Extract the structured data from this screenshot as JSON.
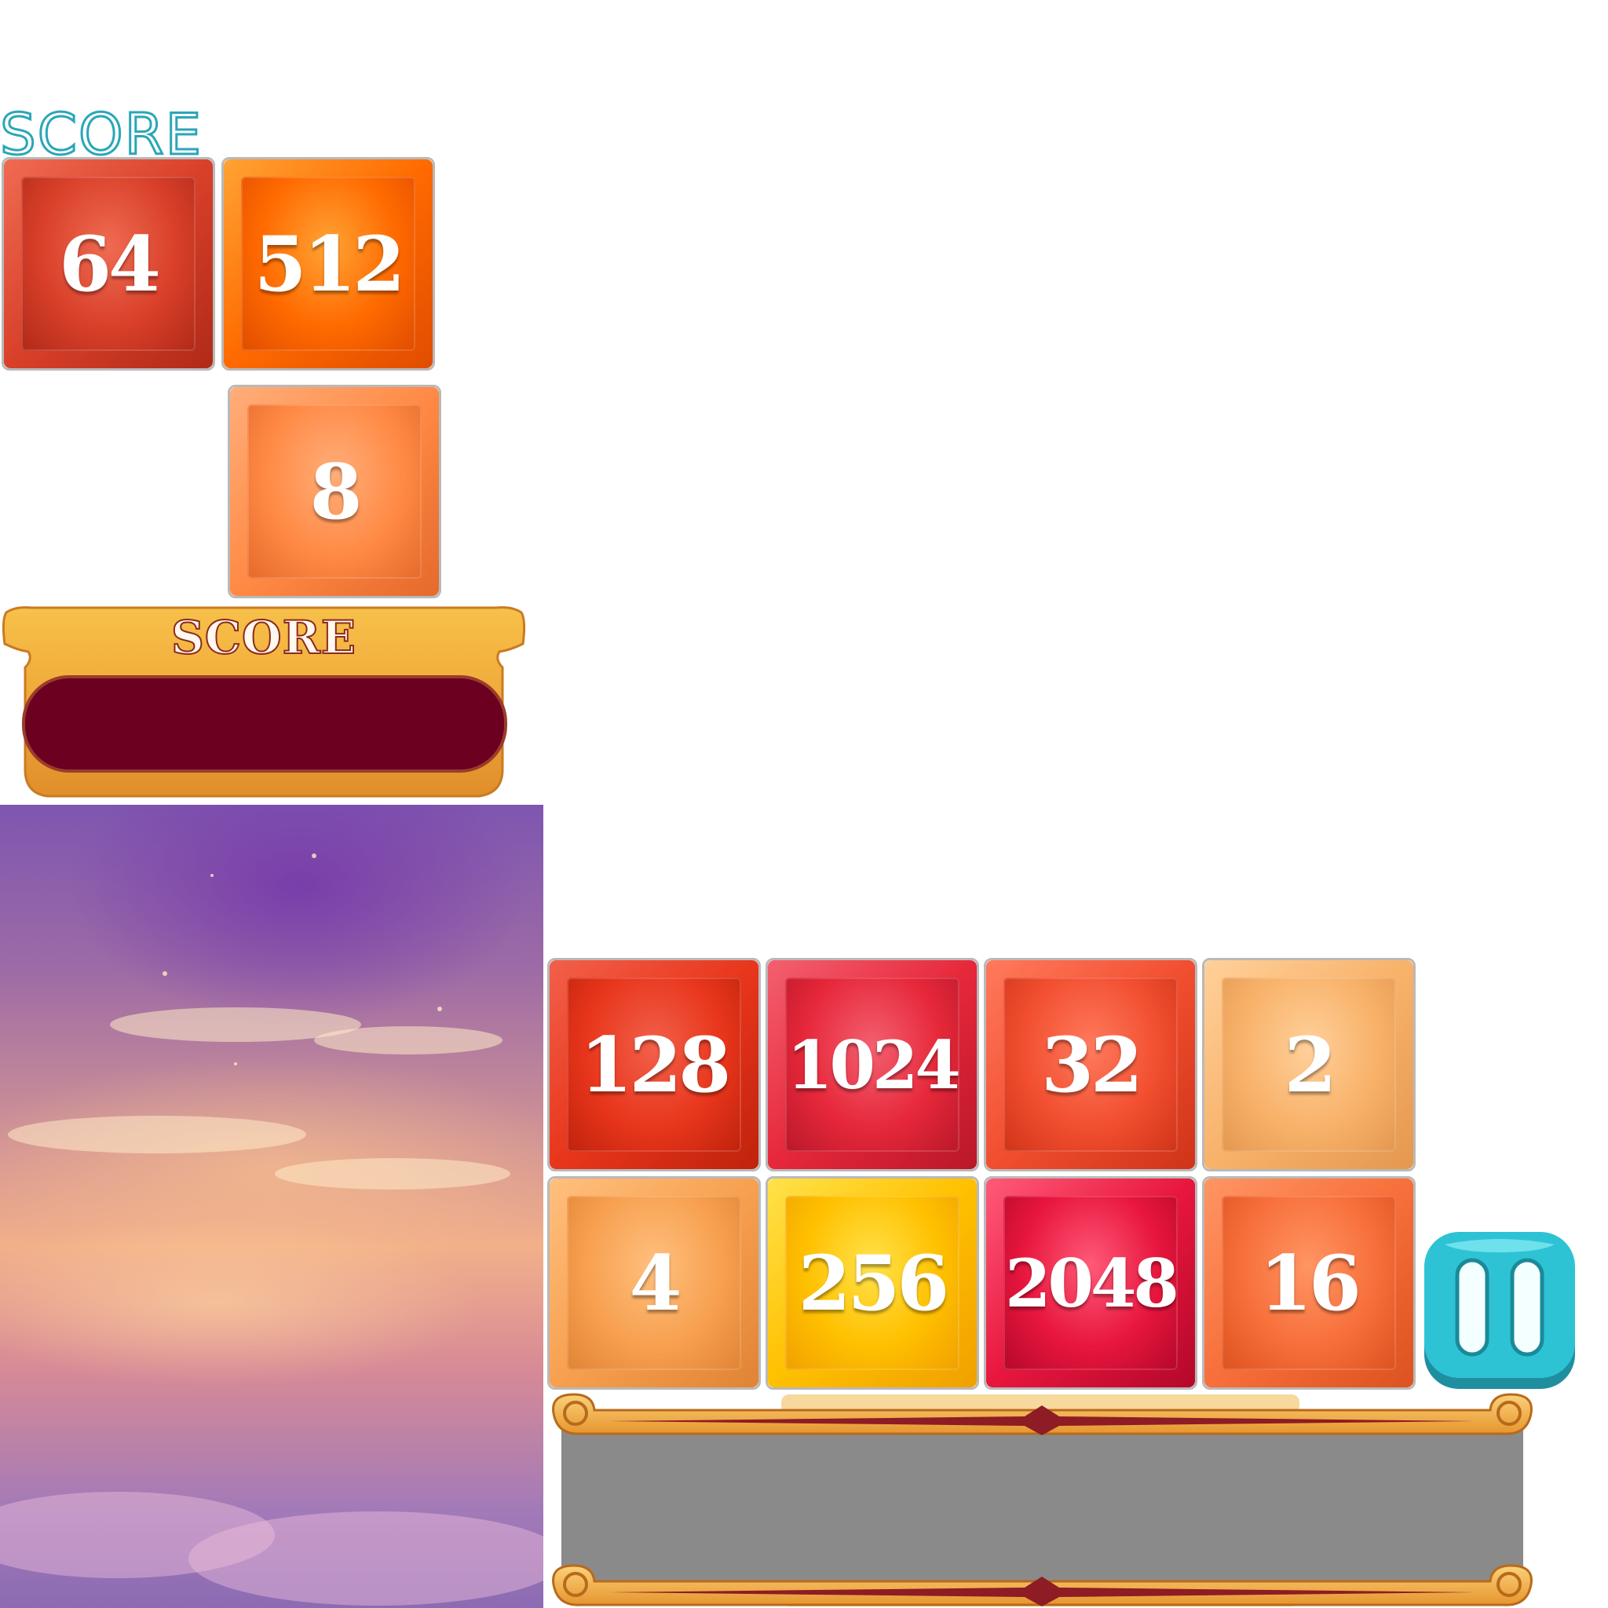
{
  "header": {
    "title_outline": "SCORE"
  },
  "tiles_top": [
    {
      "value": "64",
      "colors": {
        "base": "#d9402a",
        "light": "#ef6b52",
        "dark": "#b02a18"
      }
    },
    {
      "value": "512",
      "colors": {
        "base": "#ff6a00",
        "light": "#ffa334",
        "dark": "#e04d00"
      }
    },
    {
      "value": "8",
      "colors": {
        "base": "#ff8a45",
        "light": "#ffae7a",
        "dark": "#e56a2c"
      }
    }
  ],
  "score_panel": {
    "label": "SCORE",
    "value": ""
  },
  "tiles_board": [
    {
      "value": "128",
      "colors": {
        "base": "#e8361c",
        "light": "#f2604a",
        "dark": "#c0220c"
      }
    },
    {
      "value": "1024",
      "colors": {
        "base": "#e6283a",
        "light": "#f36070",
        "dark": "#b9182a"
      }
    },
    {
      "value": "32",
      "colors": {
        "base": "#f24e30",
        "light": "#ff7a5c",
        "dark": "#cf3418"
      }
    },
    {
      "value": "2",
      "colors": {
        "base": "#f8b26a",
        "light": "#ffd09a",
        "dark": "#e49850"
      }
    },
    {
      "value": "4",
      "colors": {
        "base": "#f7a050",
        "light": "#ffc07e",
        "dark": "#e08434"
      }
    },
    {
      "value": "256",
      "colors": {
        "base": "#ffc000",
        "light": "#ffe24a",
        "dark": "#f0a000"
      }
    },
    {
      "value": "2048",
      "colors": {
        "base": "#e8163e",
        "light": "#ff5a78",
        "dark": "#b5082a"
      }
    },
    {
      "value": "16",
      "colors": {
        "base": "#f76f3a",
        "light": "#ff9564",
        "dark": "#dc5220"
      }
    }
  ],
  "pause_button": {
    "icon": "pause-icon",
    "color": "#2ec3d4"
  },
  "board_panel": {
    "value": ""
  }
}
